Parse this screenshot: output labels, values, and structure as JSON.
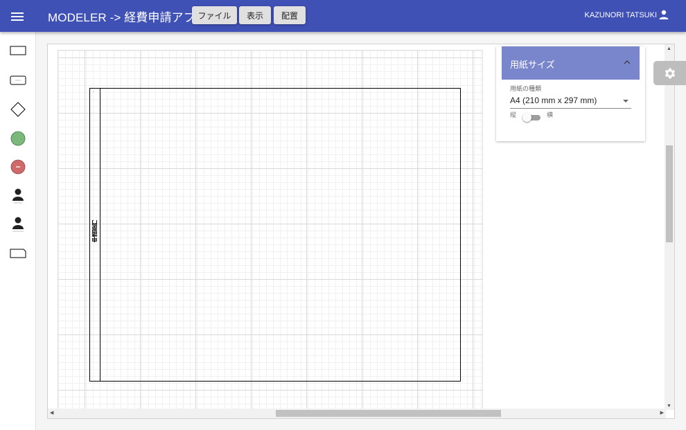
{
  "appbar": {
    "title": "MODELER -> 経費申請アプリ",
    "buttons": {
      "file": "ファイル",
      "view": "表示",
      "arrange": "配置"
    },
    "user": "KAZUNORI TATSUKI",
    "bg_color": "#3f51b5"
  },
  "toolbar": {
    "tools": [
      {
        "name": "task",
        "icon": "rectangle-icon"
      },
      {
        "name": "subprocess",
        "icon": "rounded-rectangle-icon"
      },
      {
        "name": "gateway",
        "icon": "diamond-icon"
      },
      {
        "name": "start-event",
        "icon": "green-circle-icon"
      },
      {
        "name": "end-event",
        "icon": "red-circle-icon"
      },
      {
        "name": "actor",
        "icon": "person-icon"
      },
      {
        "name": "actor-2",
        "icon": "person-icon"
      },
      {
        "name": "data",
        "icon": "tab-rectangle-icon"
      }
    ]
  },
  "canvas": {
    "pool": {
      "label": "申請部門"
    }
  },
  "panel": {
    "title": "用紙サイズ",
    "paper_type_label": "用紙の種類",
    "paper_type_value": "A4 (210 mm x 297 mm)",
    "orientation_portrait": "縦",
    "orientation_landscape": "横",
    "header_color": "#7986cb"
  }
}
